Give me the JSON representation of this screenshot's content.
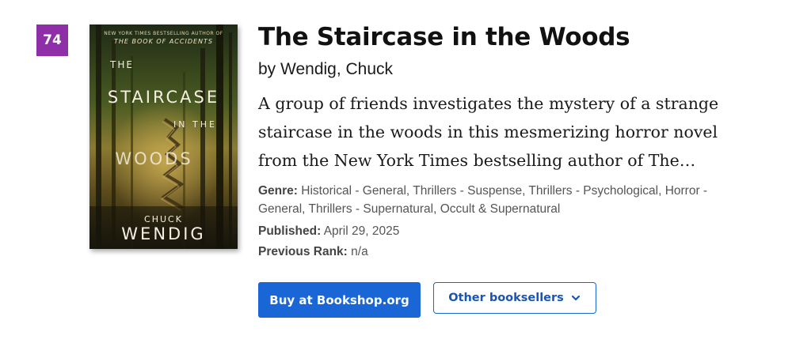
{
  "rank": "74",
  "book": {
    "title": "The Staircase in the Woods",
    "byline": "by Wendig, Chuck",
    "description": "A group of friends investigates the mystery of a strange staircase in the woods in this mesmerizing horror novel from the New York Times bestselling author of The…",
    "cover": {
      "tagline": "NEW YORK TIMES BESTSELLING AUTHOR OF",
      "tagline_book": "THE BOOK OF ACCIDENTS",
      "title_the": "THE",
      "title_staircase": "STAIRCASE",
      "title_in_the": "IN THE",
      "title_woods": "WOODS",
      "author_first": "CHUCK",
      "author_last": "WENDIG"
    }
  },
  "meta": {
    "genre_label": "Genre:",
    "genre_value": "Historical - General, Thrillers - Suspense, Thrillers - Psychological, Horror - General, Thrillers - Supernatural, Occult & Supernatural",
    "published_label": "Published:",
    "published_value": "April 29, 2025",
    "previous_rank_label": "Previous Rank:",
    "previous_rank_value": "n/a"
  },
  "actions": {
    "buy_label": "Buy at Bookshop.org",
    "other_label": "Other booksellers",
    "other_icon": "chevron-down-icon"
  },
  "colors": {
    "rank_badge": "#8e2fa8",
    "primary_button": "#1a66d6",
    "secondary_border": "#1a66d6"
  }
}
